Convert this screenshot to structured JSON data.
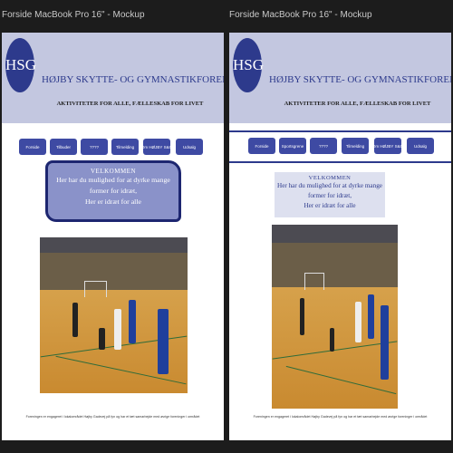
{
  "frames": [
    {
      "label": "Forside MacBook Pro 16\" - Mockup",
      "logo_text": "HSG",
      "title": "HØJBY SKYTTE- OG GYMNASTIKFORENING",
      "subtitle": "AKTIVITETER FOR ALLE, FÆLLESKAB FOR LIVET",
      "nav": [
        "Forside",
        "Tilbuder",
        "????",
        "Tilmelding",
        "Om HØJBY S&G",
        "Udsalg"
      ],
      "welcome_heading": "VELKOMMEN",
      "welcome_line1": "Her har du mulighed for at dyrke mange former for idræt,",
      "welcome_line2": "Her er idræt for alle",
      "footer": "Foreningen er engageret i lokalområdet Højby Gadevej på fyn og har et tæt samarbejde med øvrige foreninger i området"
    },
    {
      "label": "Forside MacBook Pro 16\" - Mockup",
      "logo_text": "HSG",
      "title": "HØJBY SKYTTE- OG GYMNASTIKFORENING",
      "subtitle": "AKTIVITETER FOR ALLE, FÆLLESKAB FOR LIVET",
      "nav": [
        "Forside",
        "Sportsgrene",
        "????",
        "Tilmelding",
        "Om HØJBY S&G",
        "Udsalg"
      ],
      "welcome_heading": "VELKOMMEN",
      "welcome_line1": "Her har du mulighed for at dyrke mange former for idræt,",
      "welcome_line2": "Her er idræt for alle",
      "footer": "Foreningen er engageret i lokalområdet Højby Gadevej på fyn og har et tæt samarbejde med øvrige foreninger i området"
    }
  ],
  "colors": {
    "header_bg": "#c3c7e0",
    "brand_blue": "#2d3a8c",
    "nav_button": "#3e4aa3",
    "welcome_bg_left": "#8a92c9",
    "welcome_bg_right": "#dde0ef"
  }
}
